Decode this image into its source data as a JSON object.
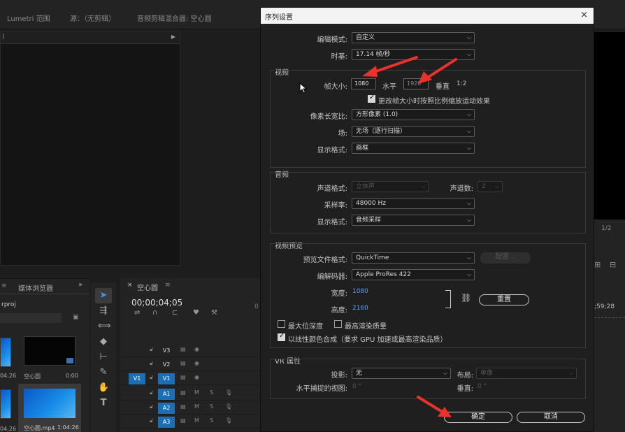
{
  "background": {
    "tabs": [
      "Lumetri 范围",
      "源：（无剪辑）",
      "音频剪辑混合器: 空心圆"
    ],
    "project": {
      "tab": "媒体浏览器",
      "file_name_partial": "rproj",
      "items": [
        {
          "label": "空心圆",
          "duration": "0;00"
        },
        {
          "label": "空心圆.mp4",
          "duration": "1:04:26"
        }
      ],
      "left_durations": [
        "04;26",
        "04;26"
      ]
    },
    "timeline": {
      "tab": "空心圆",
      "timecode": "00;00;04;05",
      "video_tracks": [
        "V3",
        "V2",
        "V1"
      ],
      "audio_tracks": [
        "A1",
        "A2",
        "A3"
      ],
      "source_patch": "V1"
    },
    "right": {
      "mini_label": "1/2",
      "timecode": ";59;28"
    }
  },
  "dialog": {
    "title": "序列设置",
    "edit_mode": {
      "label": "编辑模式:",
      "value": "自定义"
    },
    "timebase": {
      "label": "时基:",
      "value": "17.14  帧/秒"
    },
    "video": {
      "title": "视频",
      "frame_size_label": "帧大小:",
      "frame_width": "1080",
      "horizontal_label": "水平",
      "frame_height": "1920",
      "vertical_label": "垂直",
      "ratio": "1:2",
      "scale_checkbox": "更改帧大小时按照比例缩放运动效果",
      "pixel_aspect": {
        "label": "像素长宽比:",
        "value": "方形像素 (1.0)"
      },
      "fields": {
        "label": "场:",
        "value": "无场（逐行扫描）"
      },
      "display_format": {
        "label": "显示格式:",
        "value": "画框"
      }
    },
    "audio": {
      "title": "音频",
      "channel_format": {
        "label": "声道格式:",
        "value": "立体声"
      },
      "channels": {
        "label": "声道数:",
        "value": "2"
      },
      "sample_rate": {
        "label": "采样率:",
        "value": "48000 Hz"
      },
      "display_format": {
        "label": "显示格式:",
        "value": "音频采样"
      }
    },
    "preview": {
      "title": "视频预览",
      "file_format": {
        "label": "预览文件格式:",
        "value": "QuickTime"
      },
      "configure_label": "配置...",
      "codec": {
        "label": "编解码器:",
        "value": "Apple ProRes 422"
      },
      "width": {
        "label": "宽度:",
        "value": "1080"
      },
      "height": {
        "label": "高度:",
        "value": "2160"
      },
      "reset_label": "重置",
      "max_depth": "最大位深度",
      "max_quality": "最高渲染质量",
      "linear_color": "以线性颜色合成（要求 GPU 加速或最高渲染品质）"
    },
    "vr": {
      "title": "VR 属性",
      "projection": {
        "label": "投影:",
        "value": "无"
      },
      "layout": {
        "label": "布局:",
        "value": "单像"
      },
      "h_view": {
        "label": "水平捕捉的视图:",
        "value": "0 °"
      },
      "v_view": {
        "label": "垂直:",
        "value": "0 °"
      }
    },
    "ok_label": "确定",
    "cancel_label": "取消"
  },
  "colors": {
    "accent_blue": "#1c6fb5",
    "value_blue": "#5a9ef0",
    "annotation_red": "#e8322a"
  }
}
